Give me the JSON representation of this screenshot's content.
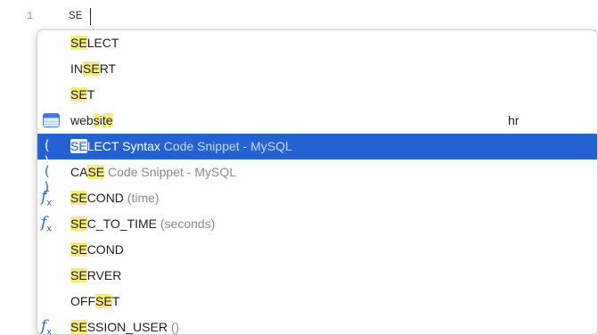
{
  "editor": {
    "line_number": "1",
    "typed_text": "SE"
  },
  "completion": {
    "items": [
      {
        "kind": "keyword",
        "pre": "",
        "match": "SE",
        "post": "LECT",
        "extra": "",
        "secondary": ""
      },
      {
        "kind": "keyword",
        "pre": "IN",
        "match": "SE",
        "post": "RT",
        "extra": "",
        "secondary": ""
      },
      {
        "kind": "keyword",
        "pre": "",
        "match": "SE",
        "post": "T",
        "extra": "",
        "secondary": ""
      },
      {
        "kind": "table",
        "pre": "web",
        "match": "s",
        "mid": "i",
        "match2": "te",
        "post": "",
        "extra": "",
        "secondary": "hr",
        "icon": "table-icon"
      },
      {
        "kind": "snippet",
        "pre": "",
        "match": "SE",
        "post": "LECT Syntax",
        "extra": " Code Snippet - MySQL",
        "secondary": "",
        "icon": "parentheses-icon",
        "selected": true
      },
      {
        "kind": "snippet",
        "pre": "CA",
        "match": "SE",
        "post": "",
        "extra": " Code Snippet - MySQL",
        "secondary": "",
        "icon": "parentheses-icon"
      },
      {
        "kind": "function",
        "pre": "",
        "match": "SE",
        "post": "COND",
        "extra": " (time)",
        "secondary": "",
        "icon": "function-icon"
      },
      {
        "kind": "function",
        "pre": "",
        "match": "SE",
        "post": "C_TO_TIME",
        "extra": " (seconds)",
        "secondary": "",
        "icon": "function-icon"
      },
      {
        "kind": "keyword",
        "pre": "",
        "match": "SE",
        "post": "COND",
        "extra": "",
        "secondary": ""
      },
      {
        "kind": "keyword",
        "pre": "",
        "match": "SE",
        "post": "RVER",
        "extra": "",
        "secondary": ""
      },
      {
        "kind": "keyword",
        "pre": "OFF",
        "match": "SE",
        "post": "T",
        "extra": "",
        "secondary": ""
      },
      {
        "kind": "function",
        "pre": "",
        "match": "SE",
        "post": "SSION_USER",
        "extra": " ()",
        "secondary": "",
        "icon": "function-icon"
      }
    ]
  },
  "colors": {
    "selection": "#2462d1",
    "match_highlight": "#f6ec7e",
    "icon_blue": "#2e66c9"
  }
}
